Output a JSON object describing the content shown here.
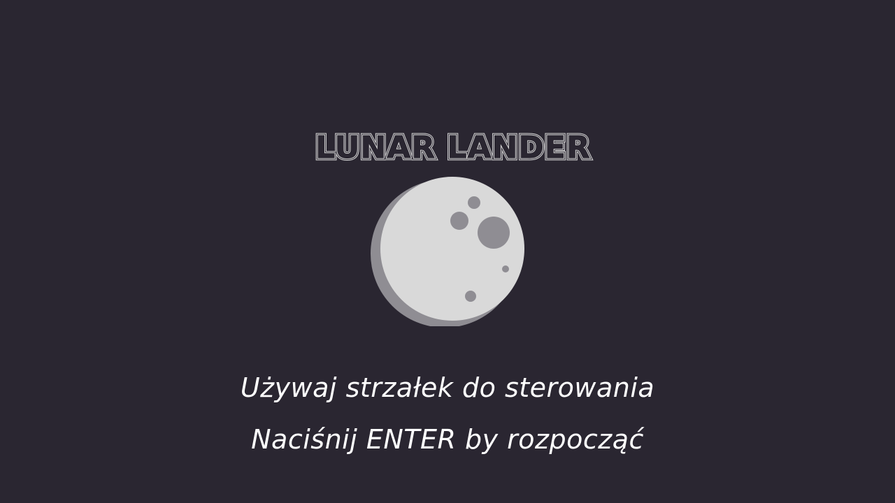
{
  "game": {
    "title": "LUNAR LANDER",
    "instructions": {
      "line1": "Używaj strzałek do sterowania",
      "line2": "Naciśnij ENTER by rozpocząć"
    }
  },
  "colors": {
    "background": "#2a2631",
    "moon_face": "#d9d9d9",
    "moon_shadow": "#8f8d93",
    "crater": "#8f8d93",
    "text": "#ffffff"
  },
  "icons": {
    "moon": "moon-icon"
  }
}
